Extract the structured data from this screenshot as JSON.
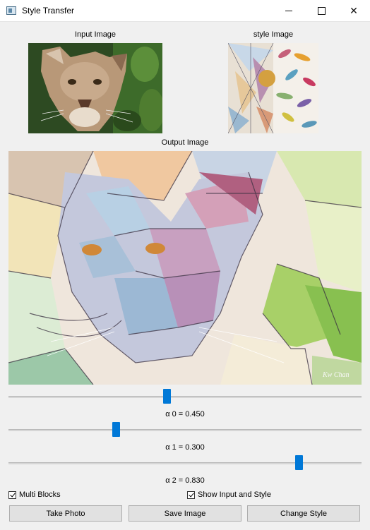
{
  "window": {
    "title": "Style Transfer"
  },
  "captions": {
    "input": "Input Image",
    "style": "style Image",
    "output": "Output Image"
  },
  "sliders": [
    {
      "label": "α 0 = 0.450",
      "value": 0.45
    },
    {
      "label": "α 1 = 0.300",
      "value": 0.3
    },
    {
      "label": "α 2 = 0.830",
      "value": 0.83
    }
  ],
  "checkboxes": {
    "multi_blocks": "Multi Blocks",
    "show_input_style": "Show Input and Style"
  },
  "buttons": {
    "take_photo": "Take Photo",
    "save_image": "Save Image",
    "change_style": "Change Style"
  },
  "colors": {
    "accent": "#0078d7"
  }
}
